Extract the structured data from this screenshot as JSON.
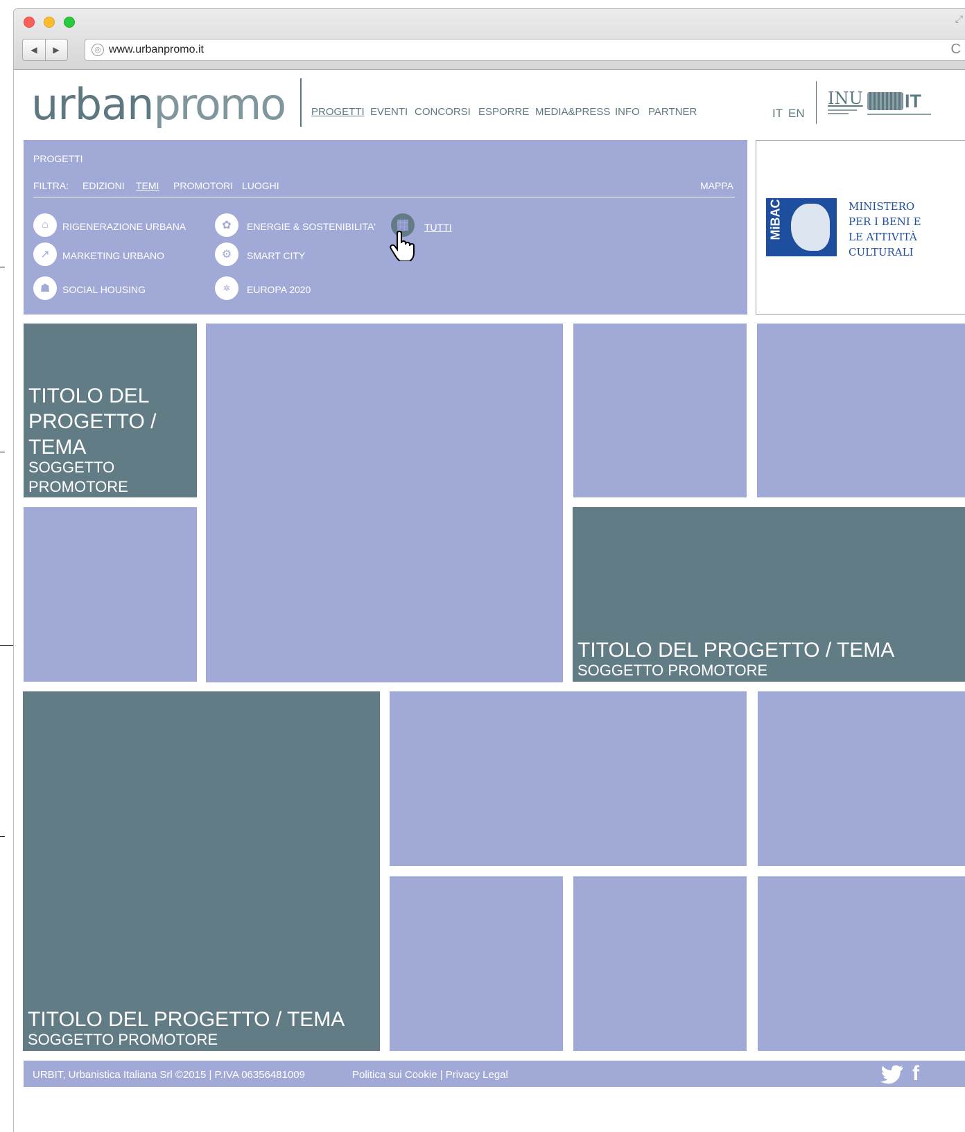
{
  "browser": {
    "url": "www.urbanpromo.it",
    "back_icon": "◀",
    "forward_icon": "▶",
    "reload_icon": "C"
  },
  "header": {
    "logo_prefix": "urban",
    "logo_suffix": "promo",
    "nav": [
      {
        "label": "PROGETTI",
        "active": true
      },
      {
        "label": "EVENTI"
      },
      {
        "label": "CONCORSI"
      },
      {
        "label": "ESPORRE"
      },
      {
        "label": "MEDIA&PRESS"
      },
      {
        "label": "INFO"
      },
      {
        "label": "PARTNER"
      }
    ],
    "lang_it": "IT",
    "lang_en": "EN",
    "partner_logos": {
      "inu": "INU",
      "urbit": "IT"
    }
  },
  "filter": {
    "section_title": "PROGETTI",
    "filter_label": "FILTRA:",
    "filters": [
      {
        "label": "EDIZIONI"
      },
      {
        "label": "TEMI",
        "active": true
      },
      {
        "label": "PROMOTORI"
      },
      {
        "label": "LUOGHI"
      }
    ],
    "map_label": "MAPPA",
    "categories": [
      {
        "label": "RIGENERAZIONE URBANA",
        "icon": "house-icon"
      },
      {
        "label": "MARKETING URBANO",
        "icon": "chart-icon"
      },
      {
        "label": "SOCIAL HOUSING",
        "icon": "people-icon"
      },
      {
        "label": "ENERGIE & SOSTENIBILITA'",
        "icon": "plant-icon"
      },
      {
        "label": "SMART CITY",
        "icon": "gear-icon"
      },
      {
        "label": "EUROPA 2020",
        "icon": "eu-stars-icon"
      }
    ],
    "all_label": "TUTTI"
  },
  "sponsor": {
    "mark": "MiBAC",
    "lines": [
      "MINISTERO",
      "PER I BENI E",
      "LE ATTIVITÀ",
      "CULTURALI"
    ]
  },
  "tiles": {
    "tile1": {
      "title": "TITOLO DEL PROGETTO / TEMA",
      "subtitle": "SOGGETTO PROMOTORE"
    },
    "tile2": {
      "title": "TITOLO DEL PROGETTO / TEMA",
      "subtitle": "SOGGETTO PROMOTORE"
    },
    "tile3": {
      "title": "TITOLO DEL PROGETTO / TEMA",
      "subtitle": "SOGGETTO PROMOTORE"
    }
  },
  "footer": {
    "copyright": "URBIT, Urbanistica Italiana Srl ©2015 | P.IVA 06356481009",
    "policy": "Politica sui Cookie | Privacy Legal",
    "twitter_icon": "twitter-icon",
    "facebook_icon": "facebook-icon"
  },
  "colors": {
    "panel": "#a1a9d6",
    "dark_tile": "#617c85",
    "brand_text": "#5d7880",
    "mibac_blue": "#1e4f9e"
  }
}
